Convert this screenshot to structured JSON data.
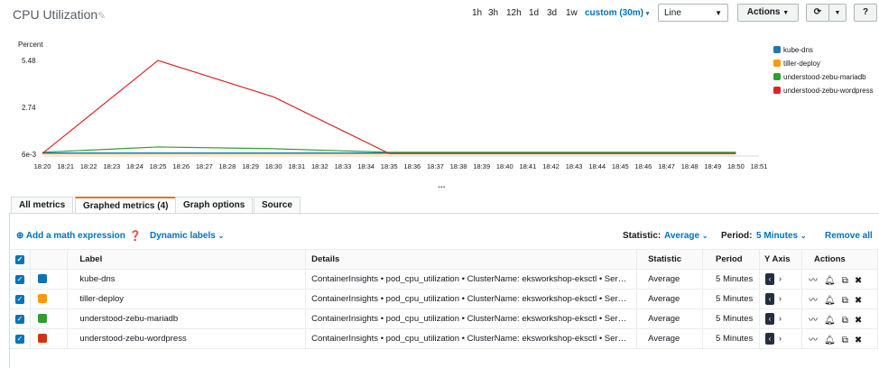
{
  "header": {
    "title": "CPU Utilization",
    "time_ranges": [
      "1h",
      "3h",
      "12h",
      "1d",
      "3d",
      "1w"
    ],
    "custom_range": "custom (30m)",
    "chart_type": "Line",
    "actions_label": "Actions"
  },
  "chart_data": {
    "type": "line",
    "ylabel": "Percent",
    "y_ticks": [
      "5.48",
      "2.74",
      "6e-3"
    ],
    "ylim": [
      0.006,
      5.48
    ],
    "x": [
      "18:20",
      "18:21",
      "18:22",
      "18:23",
      "18:24",
      "18:25",
      "18:26",
      "18:27",
      "18:28",
      "18:29",
      "18:30",
      "18:31",
      "18:32",
      "18:33",
      "18:34",
      "18:35",
      "18:36",
      "18:37",
      "18:38",
      "18:39",
      "18:40",
      "18:41",
      "18:42",
      "18:43",
      "18:44",
      "18:45",
      "18:46",
      "18:47",
      "18:48",
      "18:49",
      "18:50",
      "18:51"
    ],
    "series": [
      {
        "name": "kube-dns",
        "color": "#1f77b4",
        "points": [
          [
            0,
            0.08
          ],
          [
            5,
            0.08
          ],
          [
            10,
            0.08
          ],
          [
            15,
            0.08
          ],
          [
            30,
            0.08
          ]
        ]
      },
      {
        "name": "tiller-deploy",
        "color": "#ff9900",
        "points": [
          [
            0,
            0.03
          ],
          [
            5,
            0.03
          ],
          [
            10,
            0.03
          ],
          [
            15,
            0.03
          ],
          [
            30,
            0.03
          ]
        ]
      },
      {
        "name": "understood-zebu-mariadb",
        "color": "#2ca02c",
        "points": [
          [
            0,
            0.12
          ],
          [
            5,
            0.43
          ],
          [
            10,
            0.33
          ],
          [
            15,
            0.12
          ],
          [
            30,
            0.12
          ]
        ]
      },
      {
        "name": "understood-zebu-wordpress",
        "color": "#d62728",
        "points": [
          [
            0,
            0.05
          ],
          [
            5,
            5.48
          ],
          [
            10,
            3.35
          ],
          [
            15,
            0.05
          ],
          [
            30,
            0.05
          ]
        ]
      }
    ],
    "legend_position": "right"
  },
  "tabs": [
    "All metrics",
    "Graphed metrics (4)",
    "Graph options",
    "Source"
  ],
  "toolbar": {
    "add_math": "Add a math expression",
    "dynamic_labels": "Dynamic labels",
    "statistic_label": "Statistic:",
    "statistic_value": "Average",
    "period_label": "Period:",
    "period_value": "5 Minutes",
    "remove_all": "Remove all"
  },
  "table": {
    "headers": [
      "Label",
      "Details",
      "Statistic",
      "Period",
      "Y Axis",
      "Actions"
    ],
    "rows": [
      {
        "label": "kube-dns",
        "color": "#0073bb",
        "details": "ContainerInsights • pod_cpu_utilization • ClusterName: eksworkshop-eksctl • Ser…",
        "statistic": "Average",
        "period": "5 Minutes"
      },
      {
        "label": "tiller-deploy",
        "color": "#ff9900",
        "details": "ContainerInsights • pod_cpu_utilization • ClusterName: eksworkshop-eksctl • Ser…",
        "statistic": "Average",
        "period": "5 Minutes"
      },
      {
        "label": "understood-zebu-mariadb",
        "color": "#2ca02c",
        "details": "ContainerInsights • pod_cpu_utilization • ClusterName: eksworkshop-eksctl • Ser…",
        "statistic": "Average",
        "period": "5 Minutes"
      },
      {
        "label": "understood-zebu-wordpress",
        "color": "#d13212",
        "details": "ContainerInsights • pod_cpu_utilization • ClusterName: eksworkshop-eksctl • Ser…",
        "statistic": "Average",
        "period": "5 Minutes"
      }
    ]
  }
}
